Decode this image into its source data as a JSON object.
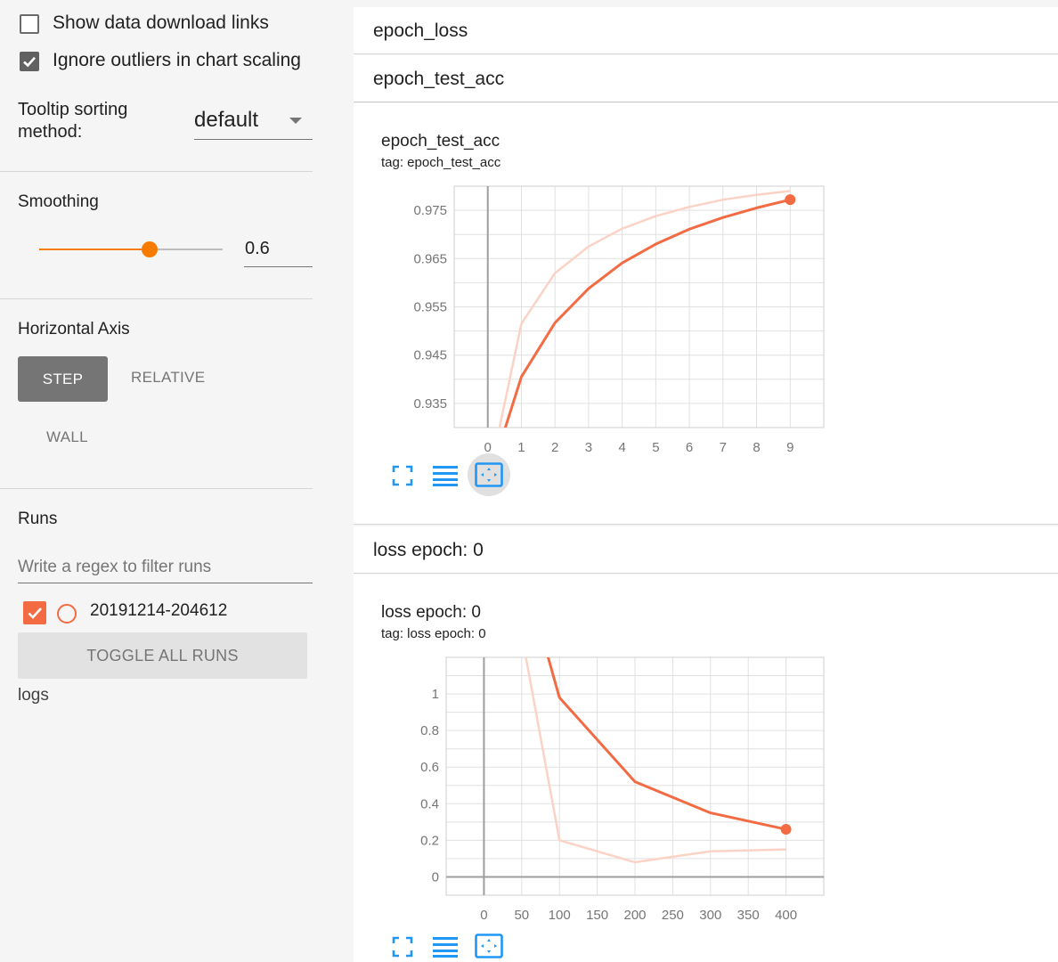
{
  "sidebar": {
    "show_download_links": {
      "label": "Show data download links",
      "checked": false
    },
    "ignore_outliers": {
      "label": "Ignore outliers in chart scaling",
      "checked": true
    },
    "tooltip_sorting": {
      "label_line1": "Tooltip sorting",
      "label_line2": "method:",
      "value": "default"
    },
    "smoothing": {
      "title": "Smoothing",
      "value": "0.6",
      "fraction": 0.6
    },
    "horizontal_axis": {
      "title": "Horizontal Axis",
      "options": [
        "STEP",
        "RELATIVE",
        "WALL"
      ],
      "selected": "STEP"
    },
    "runs": {
      "title": "Runs",
      "filter_placeholder": "Write a regex to filter runs",
      "items": [
        {
          "name": "20191214-204612",
          "checked": true
        }
      ],
      "toggle_all_label": "TOGGLE ALL RUNS",
      "logs_label": "logs"
    }
  },
  "main": {
    "groups": [
      {
        "label": "epoch_loss"
      },
      {
        "label": "epoch_test_acc"
      },
      {
        "label": "loss epoch: 0"
      }
    ],
    "charts": [
      {
        "title": "epoch_test_acc",
        "tag": "tag: epoch_test_acc"
      },
      {
        "title": "loss epoch: 0",
        "tag": "tag: loss epoch: 0"
      }
    ]
  },
  "colors": {
    "accent": "#f57c00",
    "series": "#f26b43",
    "series_raw": "#fbd3c6",
    "selected_button": "#757575",
    "icon": "#2196f3"
  },
  "icons": [
    "check-icon",
    "dropdown-arrow-icon",
    "fullscreen-icon",
    "data-table-icon",
    "fit-domain-icon"
  ],
  "chart_data": [
    {
      "type": "line",
      "title": "epoch_test_acc",
      "x": [
        0,
        1,
        2,
        3,
        4,
        5,
        6,
        7,
        8,
        9
      ],
      "x_ticks": [
        0,
        1,
        2,
        3,
        4,
        5,
        6,
        7,
        8,
        9
      ],
      "y_ticks": [
        "0.935",
        "0.945",
        "0.955",
        "0.965",
        "0.975"
      ],
      "xlim": [
        -1,
        10
      ],
      "ylim": [
        0.93,
        0.98
      ],
      "grid": true,
      "series": [
        {
          "role": "smoothed",
          "values": [
            0.9185,
            0.9405,
            0.9517,
            0.9588,
            0.9641,
            0.968,
            0.9711,
            0.9735,
            0.9755,
            0.9772
          ]
        },
        {
          "role": "raw",
          "values": [
            0.9185,
            0.9515,
            0.962,
            0.9675,
            0.9712,
            0.9738,
            0.9757,
            0.9772,
            0.9782,
            0.979
          ]
        }
      ]
    },
    {
      "type": "line",
      "title": "loss epoch: 0",
      "x": [
        0,
        100,
        200,
        300,
        400
      ],
      "x_ticks": [
        0,
        50,
        100,
        150,
        200,
        250,
        300,
        350,
        400
      ],
      "y_ticks": [
        "0",
        "0.2",
        "0.4",
        "0.6",
        "0.8",
        "1"
      ],
      "xlim": [
        -50,
        450
      ],
      "ylim": [
        -0.1,
        1.2
      ],
      "grid": true,
      "series": [
        {
          "role": "smoothed",
          "values": [
            2.45,
            0.98,
            0.52,
            0.35,
            0.26
          ]
        },
        {
          "role": "raw",
          "values": [
            2.45,
            0.2,
            0.08,
            0.14,
            0.15
          ]
        }
      ]
    }
  ]
}
